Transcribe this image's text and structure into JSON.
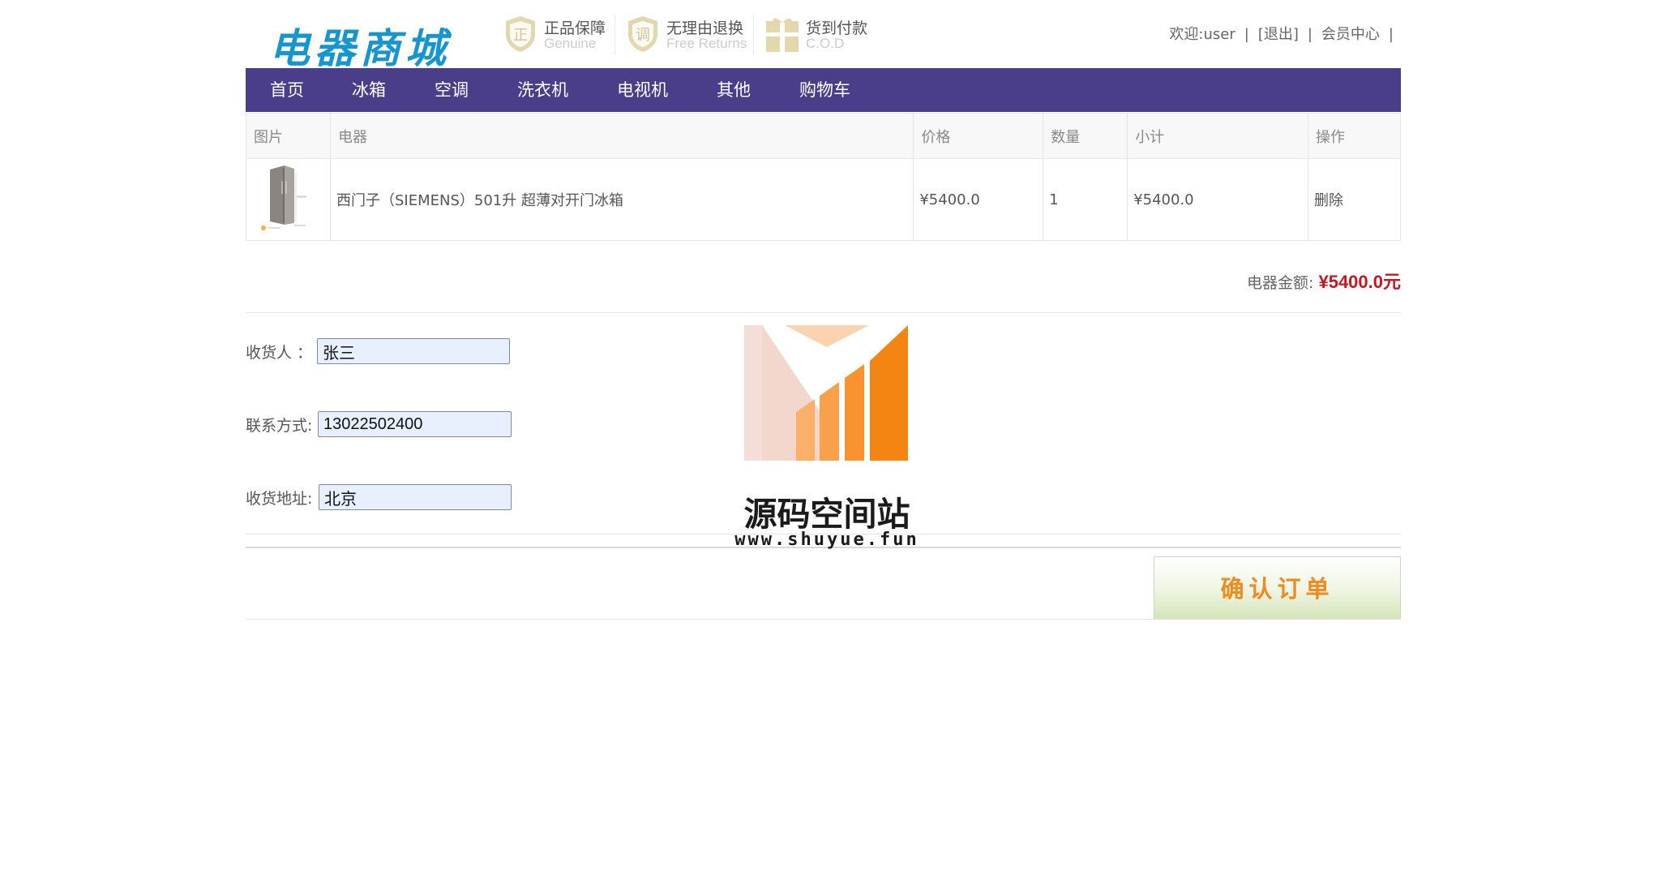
{
  "header": {
    "logo_text": "电器商城",
    "badges": [
      {
        "title": "正品保障",
        "subtitle": "Genuine",
        "icon": "genuine-shield-icon"
      },
      {
        "title": "无理由退换",
        "subtitle": "Free Returns",
        "icon": "returns-shield-icon"
      },
      {
        "title": "货到付款",
        "subtitle": "C.O.D",
        "icon": "cod-gift-icon"
      }
    ],
    "user": {
      "welcome": "欢迎:user",
      "sep": "|",
      "logout": "[退出]",
      "member_center": "会员中心"
    }
  },
  "nav": {
    "items": [
      "首页",
      "冰箱",
      "空调",
      "洗衣机",
      "电视机",
      "其他",
      "购物车"
    ],
    "bg_color": "#4a3d8a"
  },
  "cart": {
    "headers": [
      "图片",
      "电器",
      "价格",
      "数量",
      "小计",
      "操作"
    ],
    "rows": [
      {
        "image": "fridge-image",
        "name": "西门子（SIEMENS）501升 超薄对开门冰箱",
        "price": "¥5400.0",
        "qty": "1",
        "subtotal": "¥5400.0",
        "action": "删除"
      }
    ]
  },
  "total": {
    "label": "电器金额:",
    "value": "¥5400.0元",
    "color": "#c8161d"
  },
  "form": {
    "receiver_label": "收货人 ：",
    "receiver_value": "张三",
    "phone_label": "联系方式:",
    "phone_value": "13022502400",
    "address_label": "收货地址:",
    "address_value": "北京"
  },
  "confirm_label": "确认订单",
  "watermark": {
    "title": "源码空间站",
    "url": "www.shuyue.fun"
  }
}
